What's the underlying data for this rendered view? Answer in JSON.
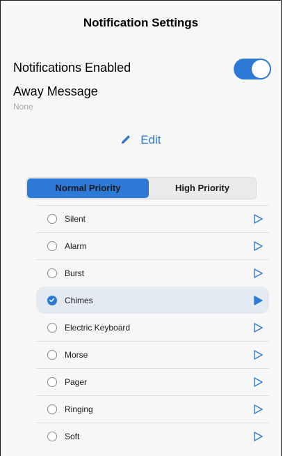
{
  "header": {
    "title": "Notification Settings"
  },
  "settings": {
    "notifications_enabled_label": "Notifications Enabled",
    "notifications_enabled": true,
    "away_message_label": "Away Message",
    "away_message_value": "None",
    "edit_label": "Edit"
  },
  "priority_tabs": {
    "normal": "Normal Priority",
    "high": "High Priority",
    "selected": "normal"
  },
  "sounds": [
    {
      "label": "Silent",
      "selected": false
    },
    {
      "label": "Alarm",
      "selected": false
    },
    {
      "label": "Burst",
      "selected": false
    },
    {
      "label": "Chimes",
      "selected": true
    },
    {
      "label": "Electric Keyboard",
      "selected": false
    },
    {
      "label": "Morse",
      "selected": false
    },
    {
      "label": "Pager",
      "selected": false
    },
    {
      "label": "Ringing",
      "selected": false
    },
    {
      "label": "Soft",
      "selected": false
    }
  ],
  "colors": {
    "accent": "#2d7ad6",
    "selected_row_bg": "#e4eaf1",
    "secondary_text": "#a6a6a6"
  },
  "icons": {
    "edit": "pencil-icon",
    "play": "play-icon",
    "radio": "radio-button-icon"
  }
}
